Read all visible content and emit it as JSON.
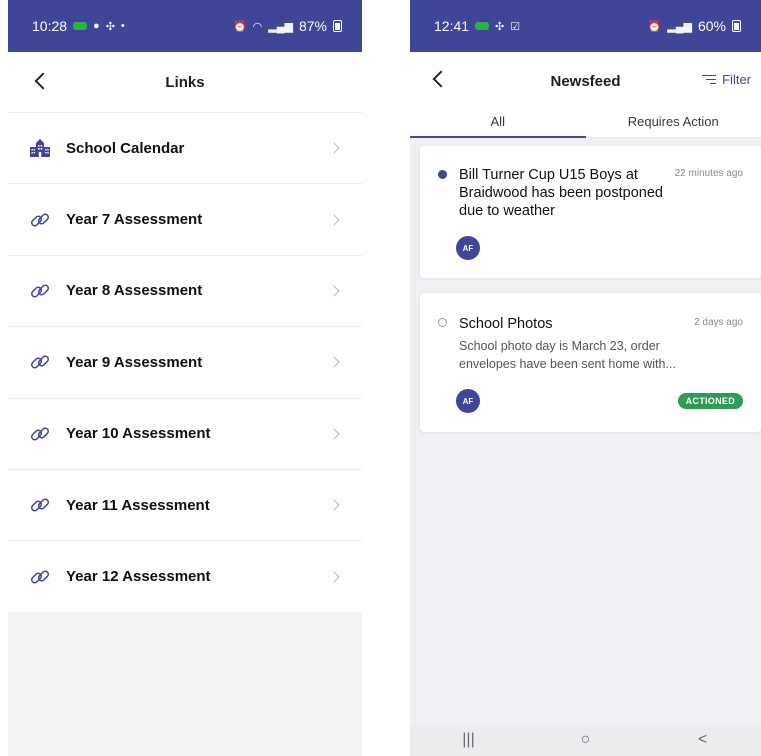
{
  "left": {
    "status": {
      "time": "10:28",
      "battery": "87%"
    },
    "header": {
      "title": "Links"
    },
    "links": [
      {
        "label": "School Calendar",
        "icon": "school-building-icon"
      },
      {
        "label": "Year 7 Assessment",
        "icon": "link-icon"
      },
      {
        "label": "Year 8 Assessment",
        "icon": "link-icon"
      },
      {
        "label": "Year 9 Assessment",
        "icon": "link-icon"
      },
      {
        "label": "Year 10 Assessment",
        "icon": "link-icon"
      },
      {
        "label": "Year 11 Assessment",
        "icon": "link-icon"
      },
      {
        "label": "Year 12 Assessment",
        "icon": "link-icon"
      }
    ]
  },
  "right": {
    "status": {
      "time": "12:41",
      "battery": "60%"
    },
    "header": {
      "title": "Newsfeed",
      "filter_label": "Filter"
    },
    "tabs": [
      {
        "label": "All",
        "active": true
      },
      {
        "label": "Requires Action",
        "active": false
      }
    ],
    "posts": [
      {
        "title": "Bill Turner Cup U15 Boys at Braidwood has been postponed due to weather",
        "time": "22 minutes ago",
        "unread": true,
        "avatar": "AF"
      },
      {
        "title": "School Photos",
        "time": "2 days ago",
        "excerpt": "School photo day is March 23, order envelopes have been sent home with...",
        "unread": false,
        "avatar": "AF",
        "badge": "ACTIONED"
      }
    ],
    "nav": {
      "recent": "|||",
      "home": "○",
      "back": "<"
    }
  },
  "colors": {
    "brand": "#3f4597",
    "success": "#2e9a55",
    "background": "#eff0f3"
  }
}
